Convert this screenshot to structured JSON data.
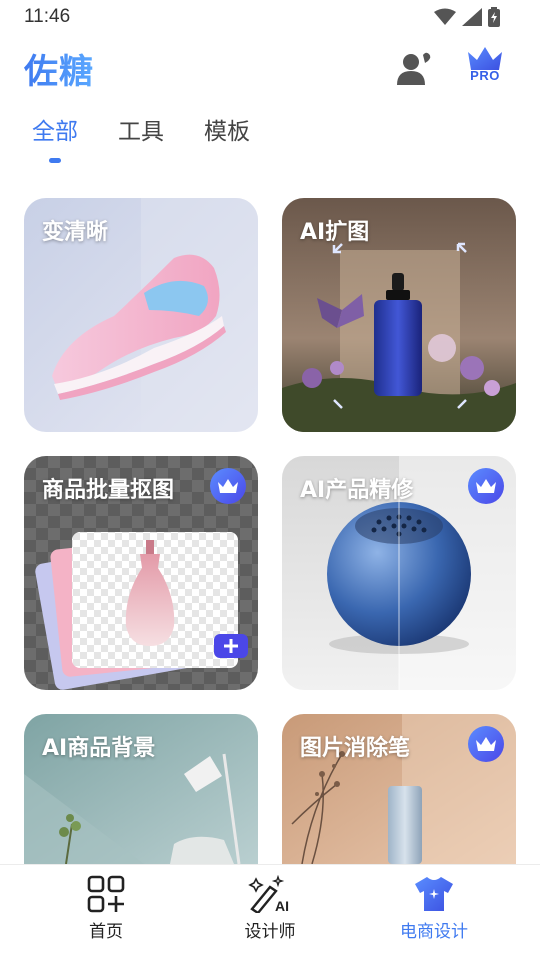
{
  "status_bar": {
    "time": "11:46",
    "icons": [
      "wifi-icon",
      "signal-icon",
      "battery-icon"
    ]
  },
  "app_bar": {
    "brand": "佐糖",
    "profile_icon": "user-icon",
    "pro_badge": {
      "icon": "crown-icon",
      "label": "PRO"
    },
    "brand_color": "#3f7af0"
  },
  "tabs": [
    {
      "label": "全部",
      "active": true
    },
    {
      "label": "工具",
      "active": false
    },
    {
      "label": "模板",
      "active": false
    }
  ],
  "cards": [
    {
      "title": "变清晰",
      "premium": false,
      "image": "pink sneaker"
    },
    {
      "title": "AI扩图",
      "premium": false,
      "image": "blue serum bottle with butterfly and flowers"
    },
    {
      "title": "商品批量抠图",
      "premium": true,
      "image": "pink perfume bottle on transparent layers"
    },
    {
      "title": "AI产品精修",
      "premium": true,
      "image": "blue spherical speaker"
    },
    {
      "title": "AI商品背景",
      "premium": false,
      "image": "room with floor lamp and plant"
    },
    {
      "title": "图片消除笔",
      "premium": true,
      "image": "dried flowers and bottle on peach backdrop"
    }
  ],
  "bottom_nav": [
    {
      "label": "首页",
      "icon": "home-grid-icon",
      "active": false
    },
    {
      "label": "设计师",
      "icon": "magic-wand-ai-icon",
      "active": false
    },
    {
      "label": "电商设计",
      "icon": "tshirt-icon",
      "active": true
    }
  ],
  "accent_color": "#3f7af0",
  "premium_badge_color": "#4b47e8"
}
